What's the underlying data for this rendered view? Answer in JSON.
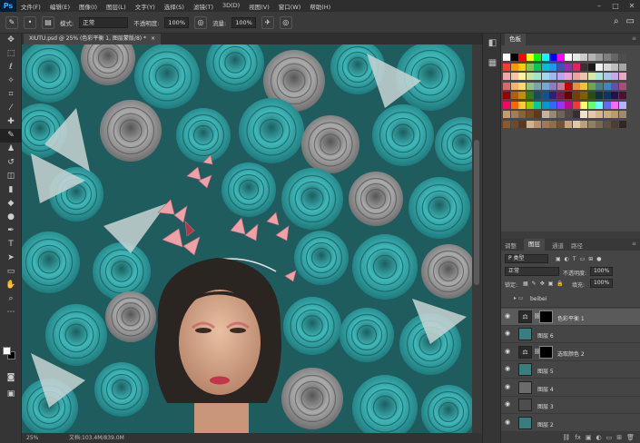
{
  "app": {
    "logo": "Ps"
  },
  "menu": [
    "文件(F)",
    "编辑(E)",
    "图像(I)",
    "图层(L)",
    "文字(Y)",
    "选择(S)",
    "滤镜(T)",
    "3D(D)",
    "视图(V)",
    "窗口(W)",
    "帮助(H)"
  ],
  "window_controls": [
    "–",
    "□",
    "✕"
  ],
  "options": {
    "mode_label": "模式:",
    "mode_value": "正常",
    "opacity_label": "不透明度:",
    "opacity_value": "100%",
    "flow_label": "流量:",
    "flow_value": "100%"
  },
  "document": {
    "tab_title": "XIUTU.psd @ 25% (色彩平衡 1, 图层蒙版/8) *",
    "close": "×",
    "zoom": "25%",
    "doc_size": "文档:103.4M/839.0M"
  },
  "swatches_panel": {
    "tab": "色板",
    "colors": [
      [
        "#ffffff",
        "#000000",
        "#ff0000",
        "#ffff00",
        "#00ff00",
        "#00ffff",
        "#0000ff",
        "#ff00ff",
        "#ffffff",
        "#e6e6e6",
        "#cccccc",
        "#b3b3b3",
        "#999999",
        "#808080",
        "#666666",
        "#4d4d4d"
      ],
      [
        "#ff3b30",
        "#ff9500",
        "#ffcc00",
        "#8bc34a",
        "#00c853",
        "#00bcd4",
        "#2196f3",
        "#3f51b5",
        "#9c27b0",
        "#e91e63",
        "#333333",
        "#1a1a1a",
        "#f2f2f2",
        "#d9d9d9",
        "#bfbfbf",
        "#a6a6a6"
      ],
      [
        "#f4a6a6",
        "#f7c59f",
        "#fff3a0",
        "#c8e6a0",
        "#a0e6c8",
        "#a0d8f0",
        "#a0b8f0",
        "#c0a0f0",
        "#f0a0d8",
        "#f0a0a0",
        "#e8c8a8",
        "#d8e8a8",
        "#a8e8d8",
        "#a8c8e8",
        "#c8a8e8",
        "#e8a8c8"
      ],
      [
        "#e06666",
        "#f6b26b",
        "#ffd966",
        "#93c47d",
        "#76a5af",
        "#6fa8dc",
        "#8e7cc3",
        "#c27ba0",
        "#cc0000",
        "#e69138",
        "#f1c232",
        "#6aa84f",
        "#45818e",
        "#3d85c6",
        "#674ea7",
        "#a64d79"
      ],
      [
        "#990000",
        "#b45f06",
        "#bf9000",
        "#38761d",
        "#134f5c",
        "#0b5394",
        "#351c75",
        "#741b47",
        "#660000",
        "#783f04",
        "#7f6000",
        "#274e13",
        "#0c343d",
        "#073763",
        "#20124d",
        "#4c1130"
      ],
      [
        "#ff0066",
        "#ff6600",
        "#ffcc33",
        "#99cc00",
        "#00cc99",
        "#0099cc",
        "#3366ff",
        "#9933ff",
        "#cc0099",
        "#ff3333",
        "#ffff66",
        "#66ff66",
        "#66ffff",
        "#6666ff",
        "#ff66ff",
        "#b3b3ff"
      ],
      [
        "#c69c6d",
        "#a67c52",
        "#8c6239",
        "#754c24",
        "#603913",
        "#c7b299",
        "#998675",
        "#736357",
        "#534741",
        "#362f2d",
        "#f2e0c9",
        "#e6c9a8",
        "#d9b38c",
        "#ccaa7a",
        "#b89b72",
        "#a08a6a"
      ],
      [
        "#8a5a2b",
        "#6e4a2a",
        "#5a3a1e",
        "#d2b48c",
        "#bc8f6a",
        "#a0785a",
        "#8b6f47",
        "#705438",
        "#c9a27a",
        "#e0c8a0",
        "#b8a080",
        "#908060",
        "#786850",
        "#605040",
        "#484030",
        "#302820"
      ]
    ]
  },
  "layers_panel": {
    "tabs": [
      "调整",
      "图层",
      "通道",
      "路径"
    ],
    "filter_label": "P 类型",
    "blend_mode": "正常",
    "opacity_label": "不透明度:",
    "opacity_value": "100%",
    "lock_label": "锁定:",
    "fill_label": "填充:",
    "fill_value": "100%",
    "layers": [
      {
        "name": "beibei",
        "kind": "group",
        "thumb": "#00000000"
      },
      {
        "name": "色彩平衡 1",
        "kind": "adjust",
        "thumb": "#2a2a2a",
        "selected": true
      },
      {
        "name": "图层 6",
        "kind": "pixel",
        "thumb": "#3a7d7f"
      },
      {
        "name": "选取颜色 2",
        "kind": "adjust",
        "thumb": "#2a2a2a"
      },
      {
        "name": "图层 5",
        "kind": "pixel",
        "thumb": "#3a7d7f"
      },
      {
        "name": "图层 4",
        "kind": "pixel",
        "thumb": "#6b6b6b"
      },
      {
        "name": "图层 3",
        "kind": "pixel",
        "thumb": "#4d4d4d"
      },
      {
        "name": "图层 2",
        "kind": "pixel",
        "thumb": "#3a7d7f"
      }
    ],
    "footer_icons": [
      "fx",
      "◐",
      "▣",
      "▭",
      "⊞",
      "🗑"
    ]
  },
  "colors": {
    "canvas_teal": "#2a8f90",
    "flower_gray": "#9a9a9a",
    "butterfly_pink": "#f2a0a8",
    "hair_dark": "#2b2522",
    "skin": "#d9a88a",
    "lips": "#c2354a"
  }
}
